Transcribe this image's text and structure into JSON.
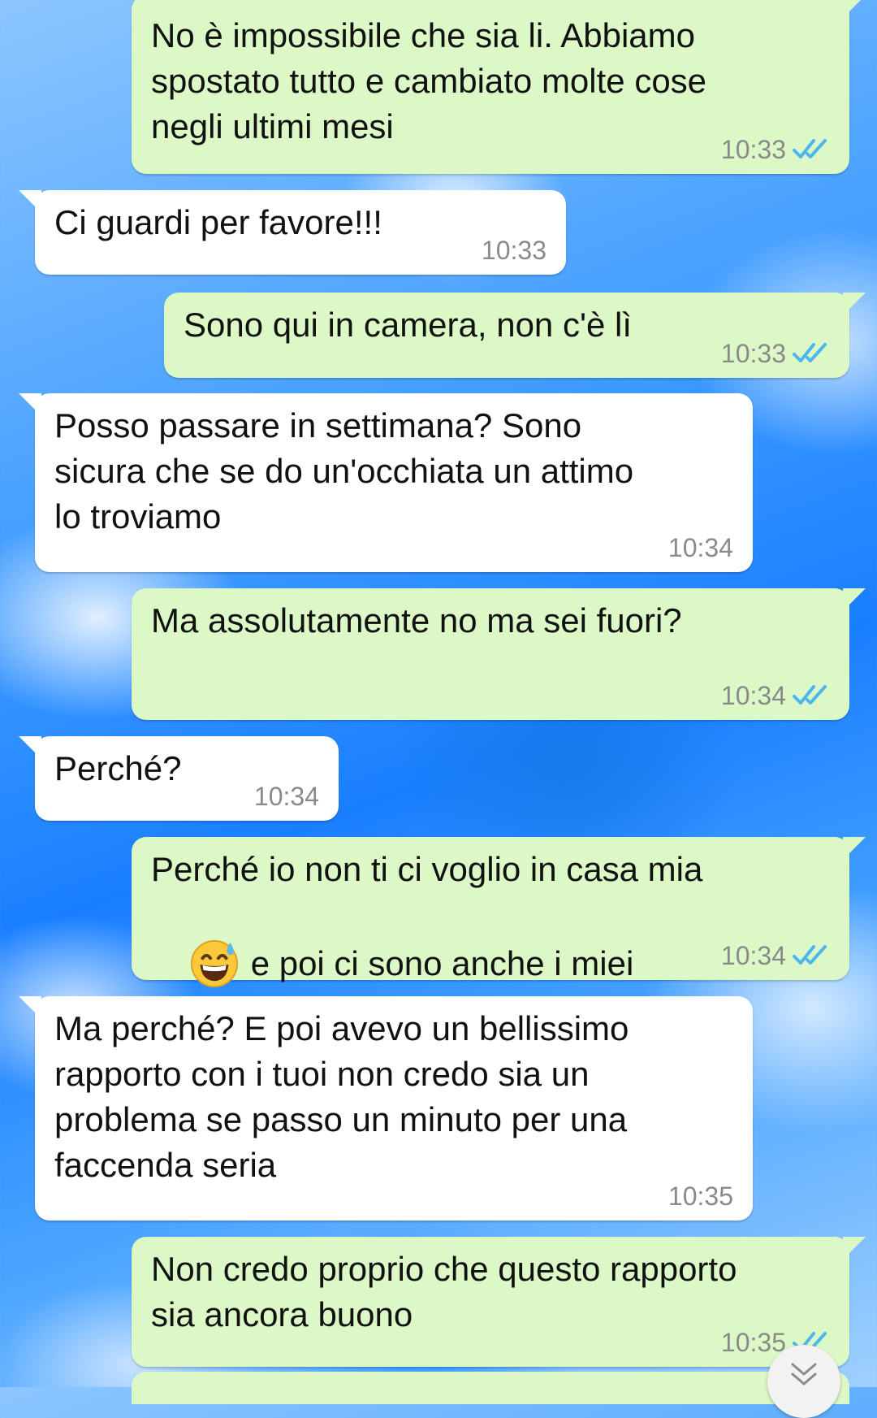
{
  "colors": {
    "outgoing_bubble": "#dcf8c6",
    "incoming_bubble": "#ffffff",
    "read_ticks": "#4fb6ec",
    "timestamp": "#8a8a8a"
  },
  "messages": [
    {
      "direction": "outgoing",
      "text": "No è impossibile che sia li. Abbiamo\nspostato tutto e cambiato molte cose\nnegli ultimi mesi",
      "time": "10:33",
      "status_icon": "double-check-read-icon"
    },
    {
      "direction": "incoming",
      "text": "Ci guardi per favore!!!",
      "time": "10:33"
    },
    {
      "direction": "outgoing",
      "text": "Sono qui in camera, non c'è lì",
      "time": "10:33",
      "status_icon": "double-check-read-icon"
    },
    {
      "direction": "incoming",
      "text": "Posso passare in settimana? Sono\nsicura che se do un'occhiata un attimo\nlo troviamo",
      "time": "10:34"
    },
    {
      "direction": "outgoing",
      "text": "Ma assolutamente no ma sei fuori?",
      "time": "10:34",
      "status_icon": "double-check-read-icon"
    },
    {
      "direction": "incoming",
      "text": "Perché?",
      "time": "10:34"
    },
    {
      "direction": "outgoing",
      "text_line1": "Perché io non ti ci voglio in casa mia",
      "text_line2": "e poi ci sono anche i miei",
      "emoji": "grinning-face-with-sweat-emoji",
      "time": "10:34",
      "status_icon": "double-check-read-icon"
    },
    {
      "direction": "incoming",
      "text": "Ma perché? E poi avevo un bellissimo\nrapporto con i tuoi non credo sia un\nproblema se passo un minuto per una\nfaccenda seria",
      "time": "10:35"
    },
    {
      "direction": "outgoing",
      "text": "Non credo proprio che questo rapporto\nsia ancora buono",
      "time": "10:35",
      "status_icon": "double-check-read-icon"
    }
  ],
  "scroll_button_icon": "chevron-down-icon"
}
